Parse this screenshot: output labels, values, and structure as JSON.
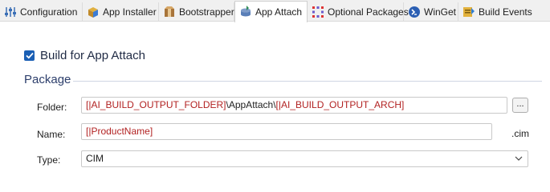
{
  "tabs": [
    {
      "label": "Configuration",
      "icon": "configuration-icon"
    },
    {
      "label": "App Installer",
      "icon": "app-installer-icon"
    },
    {
      "label": "Bootstrapper",
      "icon": "bootstrapper-icon"
    },
    {
      "label": "App Attach",
      "icon": "app-attach-icon",
      "active": true
    },
    {
      "label": "Optional Packages",
      "icon": "optional-packages-icon"
    },
    {
      "label": "WinGet",
      "icon": "winget-icon"
    },
    {
      "label": "Build Events",
      "icon": "build-events-icon"
    }
  ],
  "build_for_app_attach": {
    "label": "Build for App Attach",
    "checked": true
  },
  "package": {
    "title": "Package",
    "folder": {
      "label": "Folder:",
      "value_parts": [
        "[|AI_BUILD_OUTPUT_FOLDER]",
        "\\AppAttach\\",
        "[|AI_BUILD_OUTPUT_ARCH]"
      ],
      "browse_label": "..."
    },
    "name": {
      "label": "Name:",
      "value": "[|ProductName]",
      "extension": ".cim"
    },
    "type": {
      "label": "Type:",
      "value": "CIM"
    }
  },
  "colors": {
    "accent": "#1a5fb4",
    "variable_text": "#b22222"
  }
}
